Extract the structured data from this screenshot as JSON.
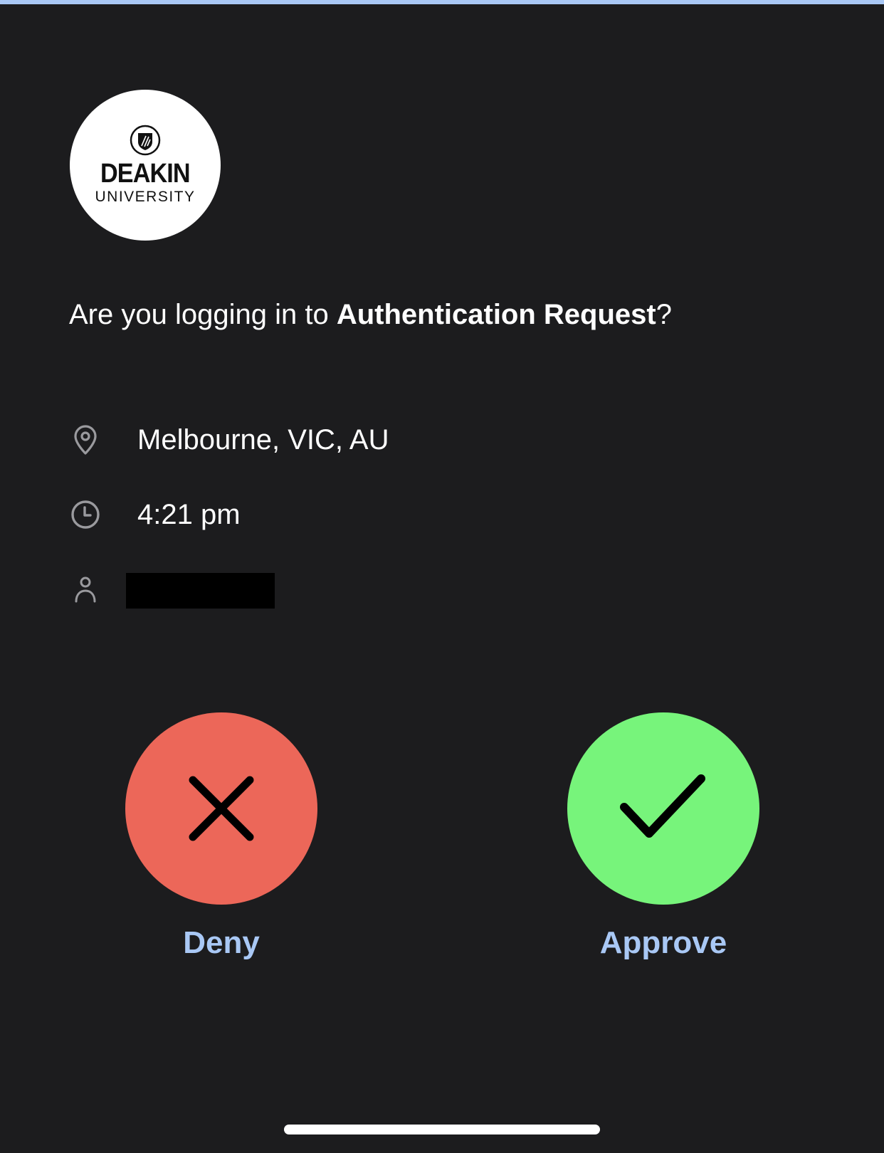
{
  "logo": {
    "name": "DEAKIN",
    "subtitle": "UNIVERSITY"
  },
  "prompt": {
    "prefix": "Are you logging in to ",
    "app_name": "Authentication Request",
    "suffix": "?"
  },
  "details": {
    "location": {
      "icon": "location-pin-icon",
      "text": "Melbourne, VIC, AU"
    },
    "time": {
      "icon": "clock-icon",
      "text": "4:21 pm"
    },
    "user": {
      "icon": "person-icon",
      "text": ""
    }
  },
  "actions": {
    "deny": {
      "icon": "close-icon",
      "label": "Deny",
      "color": "#ec6759"
    },
    "approve": {
      "icon": "checkmark-icon",
      "label": "Approve",
      "color": "#77f47b"
    }
  },
  "colors": {
    "background": "#1c1c1e",
    "accent": "#a9c8f5",
    "text": "#ffffff"
  }
}
